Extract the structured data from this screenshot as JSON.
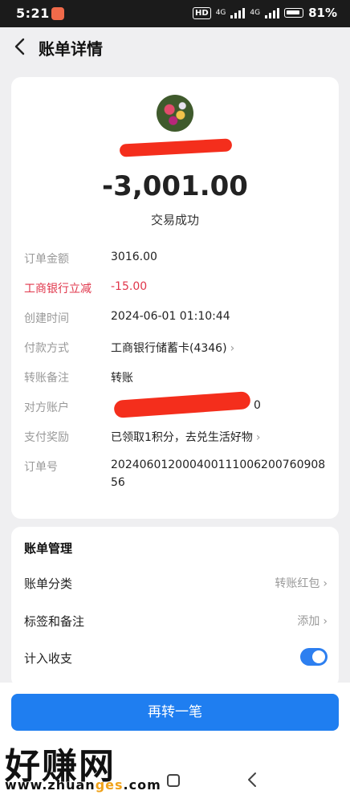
{
  "status_bar": {
    "time": "5:21",
    "network1": "4G",
    "network2": "4G",
    "hd": "HD",
    "battery": "81%"
  },
  "header": {
    "title": "账单详情"
  },
  "detail": {
    "amount": "-3,001.00",
    "status": "交易成功",
    "rows": [
      {
        "label": "订单金额",
        "value": "3016.00"
      },
      {
        "label": "工商银行立减",
        "value": "-15.00",
        "accent": "#e0364b"
      },
      {
        "label": "创建时间",
        "value": "2024-06-01 01:10:44"
      },
      {
        "label": "付款方式",
        "value": "工商银行储蓄卡(4346)"
      },
      {
        "label": "转账备注",
        "value": "转账"
      },
      {
        "label": "对方账户",
        "value": "0"
      },
      {
        "label": "支付奖励",
        "value": "已领取1积分，去兑生活好物"
      },
      {
        "label": "订单号",
        "value": "20240601200040011100620076090856"
      }
    ]
  },
  "management": {
    "title": "账单管理",
    "category_label": "账单分类",
    "category_value": "转账红包",
    "tags_label": "标签和备注",
    "tags_value": "添加",
    "include_label": "计入收支",
    "include_enabled": true
  },
  "cta": {
    "label": "再转一笔"
  },
  "watermark": {
    "line1": "好赚网",
    "line2_a": "www.zhuan",
    "line2_b": "ges",
    "line2_c": ".com"
  },
  "colors": {
    "primary": "#1f7ef0",
    "danger": "#e0364b",
    "redaction": "#f42e1c"
  }
}
